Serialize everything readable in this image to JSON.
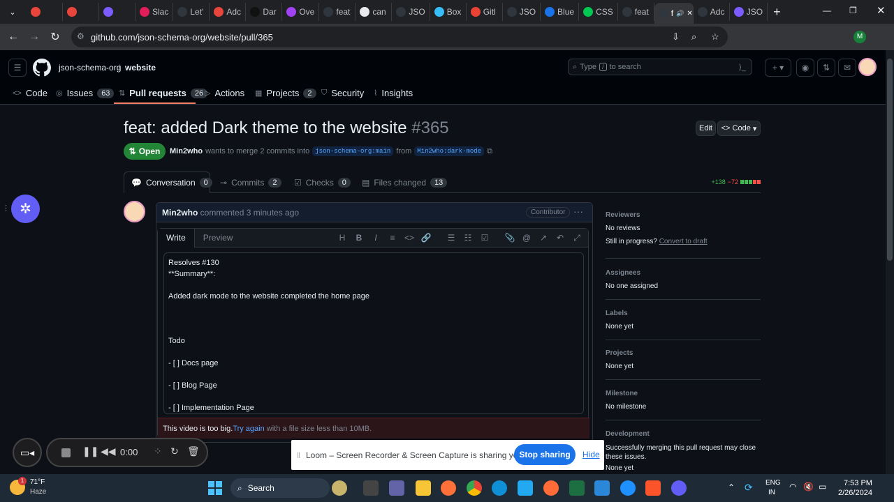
{
  "browser": {
    "tabs": [
      {
        "label": "",
        "color": "#e8453c"
      },
      {
        "label": "",
        "color": "#e8453c"
      },
      {
        "label": "",
        "color": "#7c5cff"
      },
      {
        "label": "Slac",
        "color": "#e01e5a"
      },
      {
        "label": "Let'",
        "color": "#30363d"
      },
      {
        "label": "Adc",
        "color": "#e8453c"
      },
      {
        "label": "Dar",
        "color": "#111111"
      },
      {
        "label": "Ove",
        "color": "#a142f4"
      },
      {
        "label": "feat",
        "color": "#30363d"
      },
      {
        "label": "can",
        "color": "#e8eaed"
      },
      {
        "label": "JSO",
        "color": "#30363d"
      },
      {
        "label": "Box",
        "color": "#38bdf8"
      },
      {
        "label": "Gitl",
        "color": "#ea4335"
      },
      {
        "label": "JSO",
        "color": "#30363d"
      },
      {
        "label": "Blue",
        "color": "#1a73e8"
      },
      {
        "label": "CSS",
        "color": "#00c853"
      },
      {
        "label": "feat",
        "color": "#30363d"
      },
      {
        "label": "f",
        "color": "#30363d"
      },
      {
        "label": "Adc",
        "color": "#30363d"
      },
      {
        "label": "JSO",
        "color": "#7c5cff"
      }
    ],
    "url": "github.com/json-schema-org/website/pull/365"
  },
  "github": {
    "org": "json-schema-org",
    "repo": "website",
    "search_placeholder_pre": "Type",
    "search_key": "/",
    "search_placeholder_post": "to search",
    "nav": [
      {
        "label": "Code",
        "count": ""
      },
      {
        "label": "Issues",
        "count": "63"
      },
      {
        "label": "Pull requests",
        "count": "26"
      },
      {
        "label": "Actions",
        "count": ""
      },
      {
        "label": "Projects",
        "count": "2"
      },
      {
        "label": "Security",
        "count": ""
      },
      {
        "label": "Insights",
        "count": ""
      }
    ]
  },
  "pr": {
    "title": "feat: added Dark theme to the website",
    "number": "#365",
    "edit_label": "Edit",
    "code_label": "Code",
    "state": "Open",
    "author": "Min2who",
    "merge_text": "wants to merge 2 commits into",
    "base_branch": "json-schema-org:main",
    "from_text": "from",
    "head_branch": "Min2who:dark-mode",
    "tabs": [
      {
        "label": "Conversation",
        "count": "0"
      },
      {
        "label": "Commits",
        "count": "2"
      },
      {
        "label": "Checks",
        "count": "0"
      },
      {
        "label": "Files changed",
        "count": "13"
      }
    ],
    "additions": "+138",
    "deletions": "−72"
  },
  "comment": {
    "author": "Min2who",
    "meta": "commented 3 minutes ago",
    "role": "Contributor",
    "write_tab": "Write",
    "preview_tab": "Preview",
    "body": "Resolves #130\n**Summary**:\n\nAdded dark mode to the website completed the home page\n\n\n\nTodo\n\n- [ ] Docs page\n\n- [ ] Blog Page\n\n- [ ] Implementation Page",
    "error_text": "This video is too big.",
    "error_link": "Try again",
    "error_suffix": "with a file size less than 10MB."
  },
  "sidebar": {
    "reviewers_head": "Reviewers",
    "reviewers_val": "No reviews",
    "progress_text": "Still in progress?",
    "progress_link": "Convert to draft",
    "assignees_head": "Assignees",
    "assignees_val": "No one assigned",
    "labels_head": "Labels",
    "labels_val": "None yet",
    "projects_head": "Projects",
    "projects_val": "None yet",
    "milestone_head": "Milestone",
    "milestone_val": "No milestone",
    "development_head": "Development",
    "development_val": "Successfully merging this pull request may close these issues.",
    "development_val2": "None yet"
  },
  "loom": {
    "time": "0:00",
    "share_text": "Loom – Screen Recorder & Screen Capture is sharing your screen.",
    "stop_label": "Stop sharing",
    "hide_label": "Hide"
  },
  "taskbar": {
    "weather_temp": "71°F",
    "weather_desc": "Haze",
    "weather_badge": "1",
    "search_label": "Search",
    "lang1": "ENG",
    "lang2": "IN",
    "time": "7:53 PM",
    "date": "2/26/2024"
  }
}
